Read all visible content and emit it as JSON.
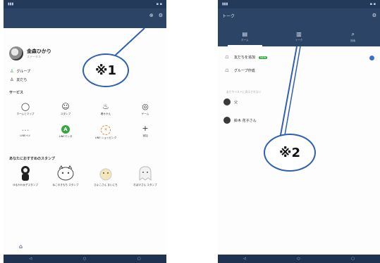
{
  "left": {
    "app_title": "",
    "profile": {
      "name": "金森ひかり",
      "status": "ステータス",
      "edit": ""
    },
    "menu": [
      {
        "icon": "♙",
        "label": "グループ"
      },
      {
        "icon": "♙",
        "label": "友だち"
      }
    ],
    "services_title": "サービス",
    "services": [
      {
        "icon": "◯",
        "label": "ホームとマップ"
      },
      {
        "icon": "☺",
        "label": "スタンプ"
      },
      {
        "icon": "♨",
        "label": "着せかえ"
      },
      {
        "icon": "◎",
        "label": "ゲーム"
      },
      {
        "icon": "…",
        "label": "LINEペイ"
      },
      {
        "icon": "A",
        "label": "LINEマンガ"
      },
      {
        "icon": "☀",
        "label": "LINE ショッピング"
      },
      {
        "icon": "+",
        "label": "追加"
      }
    ],
    "stickers_title": "あなたにおすすめのスタンプ",
    "stickers": [
      {
        "label": "ゆるかわ女子スタンプ"
      },
      {
        "label": "ねこのきもち スタンプ"
      },
      {
        "label": "ひよこさん まいにち"
      },
      {
        "label": "おばけさん スタンプ"
      }
    ],
    "annotation": "※1"
  },
  "right": {
    "app_title": "トーク",
    "tabs": [
      {
        "icon": "▤",
        "label": "ホーム"
      },
      {
        "icon": "▥",
        "label": "トーク"
      },
      {
        "icon": "⌕",
        "label": "検索"
      }
    ],
    "rows": [
      {
        "icon": "☖",
        "label": "友だちを追加",
        "badge": "NEW"
      },
      {
        "icon": "☖",
        "label": "グループ作成"
      }
    ],
    "note": "友だちリストに表示されない",
    "favorites": [
      {
        "label": "父"
      },
      {
        "label": "鈴木 花子さん"
      }
    ],
    "annotation": "※2"
  },
  "colors": {
    "header": "#2c4466",
    "accent_green": "#35a640",
    "annotation_blue": "#2f5fb3"
  }
}
